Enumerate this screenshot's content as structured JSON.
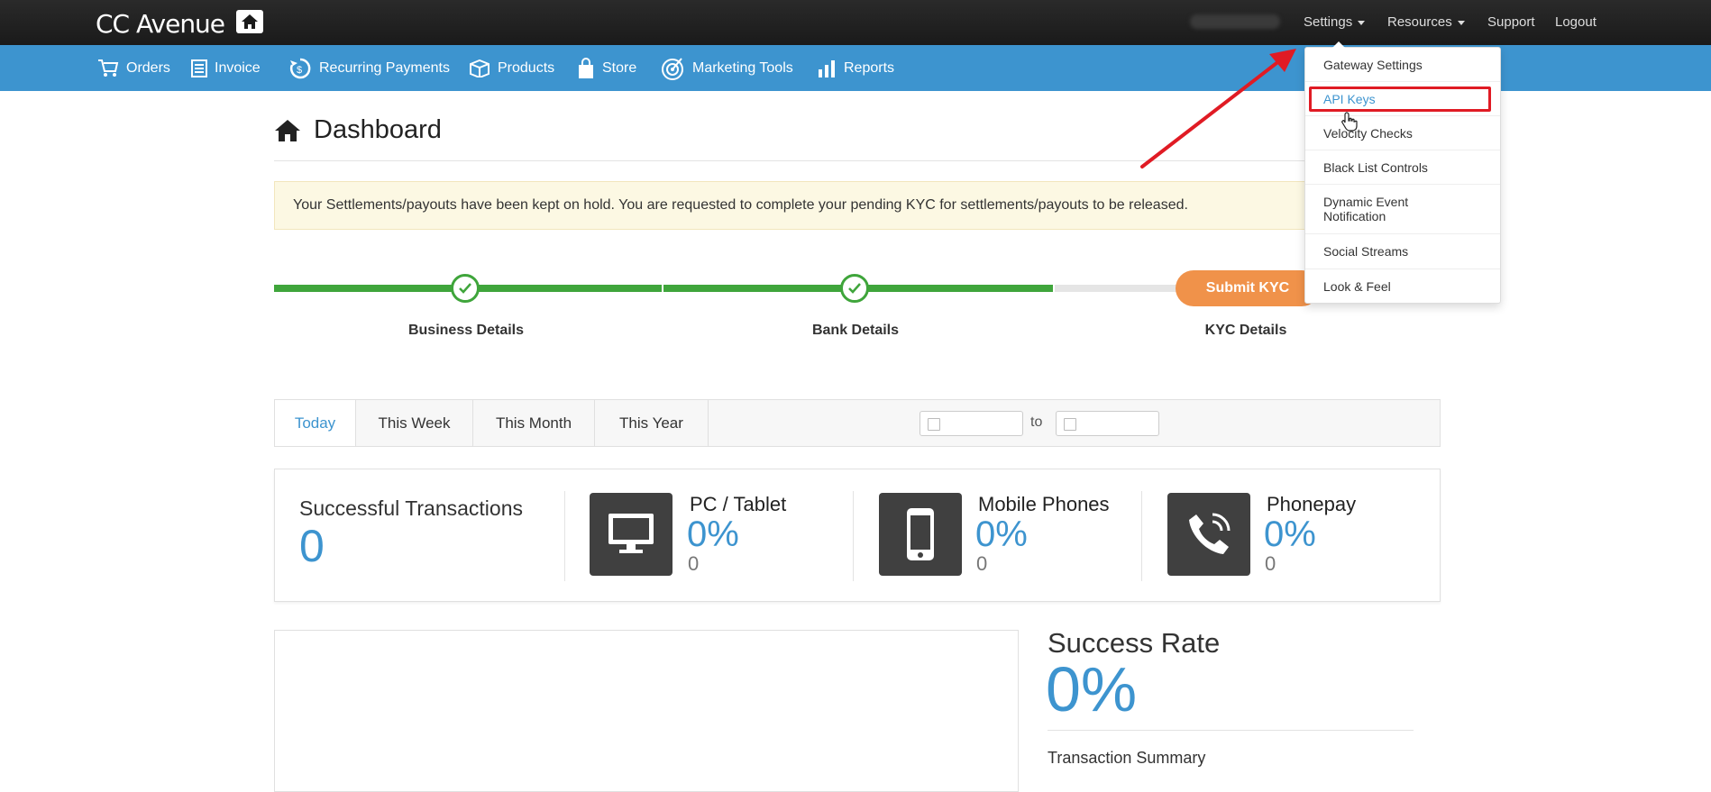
{
  "topbar": {
    "logo": "CC Avenue",
    "settings_label": "Settings",
    "resources_label": "Resources",
    "support_label": "Support",
    "logout_label": "Logout"
  },
  "menubar": {
    "items": [
      {
        "label": "Orders",
        "icon": "cart-icon"
      },
      {
        "label": "Invoice",
        "icon": "invoice-icon"
      },
      {
        "label": "Recurring Payments",
        "icon": "recurring-icon"
      },
      {
        "label": "Products",
        "icon": "box-icon"
      },
      {
        "label": "Store",
        "icon": "bag-icon"
      },
      {
        "label": "Marketing Tools",
        "icon": "target-icon"
      },
      {
        "label": "Reports",
        "icon": "bar-chart-icon"
      }
    ]
  },
  "dashboard": {
    "title": "Dashboard",
    "alert": "Your Settlements/payouts have been kept on hold. You are requested to complete your pending KYC for settlements/payouts to be released."
  },
  "kyc_steps": {
    "steps": [
      "Business Details",
      "Bank Details",
      "KYC Details"
    ],
    "submit_label": "Submit KYC"
  },
  "period_tabs": {
    "tabs": [
      "Today",
      "This Week",
      "This Month",
      "This Year"
    ],
    "active": "Today",
    "to_label": "to"
  },
  "stats": {
    "successful_title": "Successful Transactions",
    "successful_value": "0",
    "channels": [
      {
        "label": "PC / Tablet",
        "percent": "0%",
        "count": "0",
        "icon": "monitor-icon"
      },
      {
        "label": "Mobile Phones",
        "percent": "0%",
        "count": "0",
        "icon": "mobile-phone-icon"
      },
      {
        "label": "Phonepay",
        "percent": "0%",
        "count": "0",
        "icon": "phone-call-icon"
      }
    ]
  },
  "success_rate": {
    "title": "Success Rate",
    "value": "0%",
    "summary_title": "Transaction Summary"
  },
  "settings_dropdown": {
    "items": [
      "Gateway Settings",
      "API Keys",
      "Velocity Checks",
      "Black List Controls",
      "Dynamic Event Notification",
      "Social Streams",
      "Look & Feel"
    ],
    "highlighted": "API Keys"
  },
  "colors": {
    "menubar": "#3d94cf",
    "accent": "#3d94cf",
    "step_done": "#3fa53b",
    "submit_kyc": "#f0924a",
    "highlight": "#e01b24"
  }
}
